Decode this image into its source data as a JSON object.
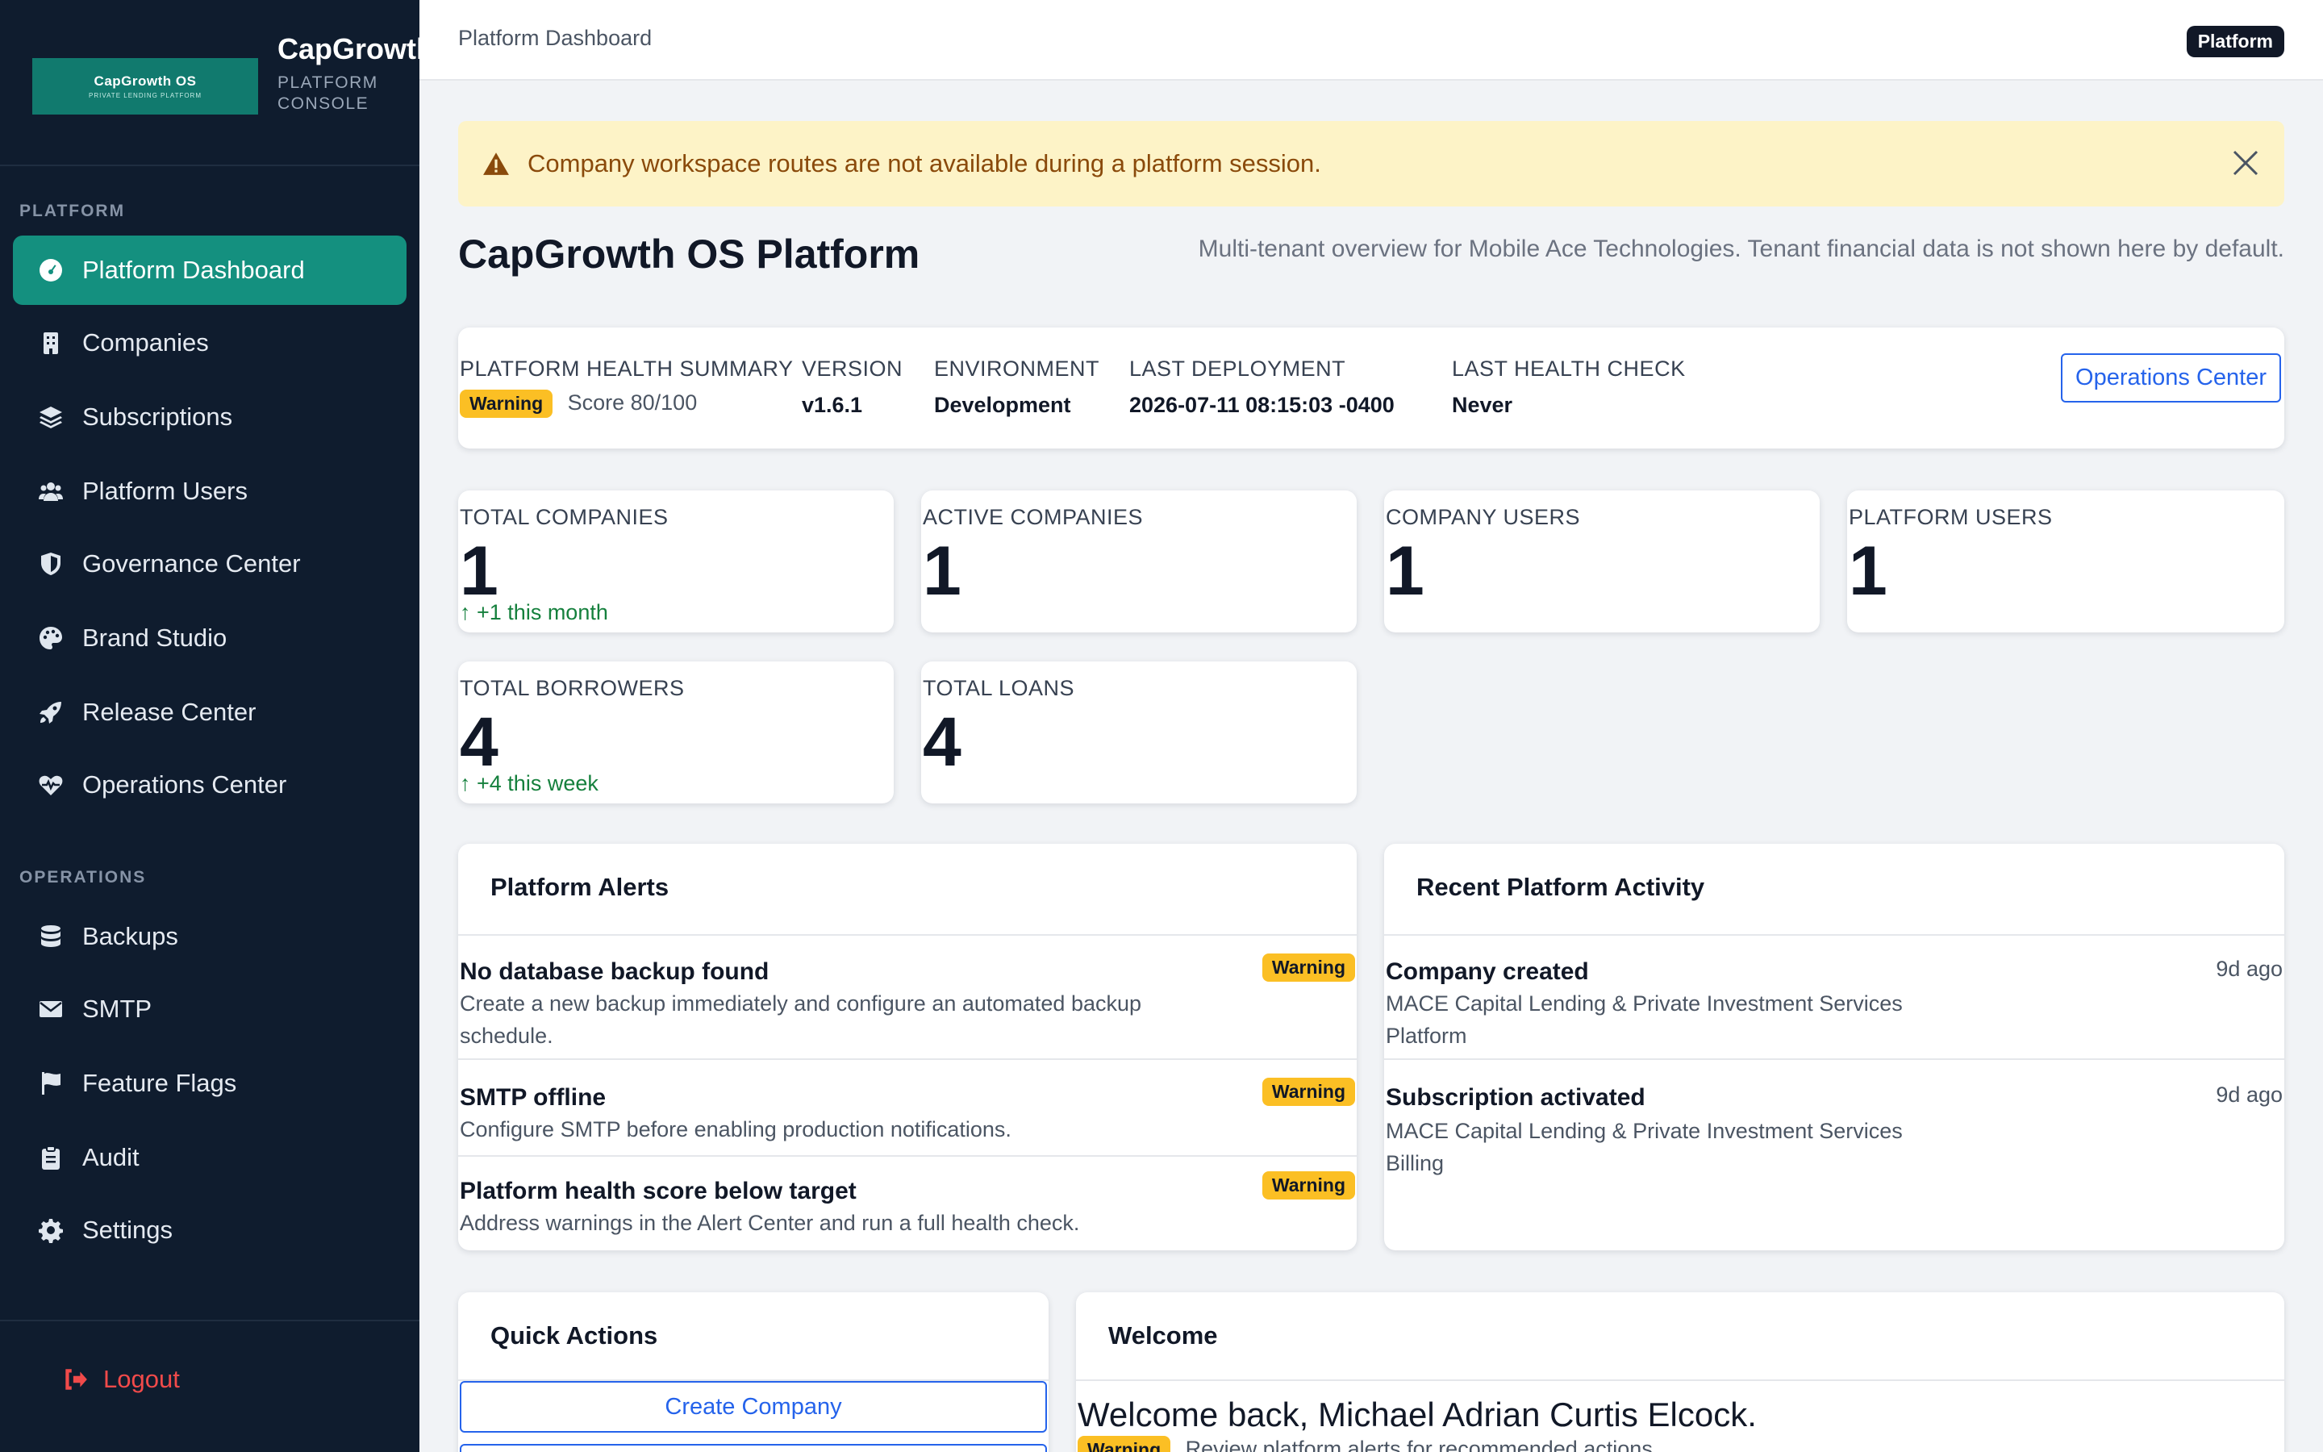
{
  "brand": {
    "logo_line1": "CapGrowth OS",
    "logo_line2": "PRIVATE LENDING PLATFORM",
    "name": "CapGrowth OS",
    "subtitle": "PLATFORM CONSOLE"
  },
  "sidebar": {
    "sections": [
      "PLATFORM",
      "OPERATIONS"
    ],
    "items": [
      {
        "label": "Platform Dashboard",
        "icon": "gauge-icon",
        "active": true
      },
      {
        "label": "Companies",
        "icon": "building-icon"
      },
      {
        "label": "Subscriptions",
        "icon": "layers-icon"
      },
      {
        "label": "Platform Users",
        "icon": "users-icon"
      },
      {
        "label": "Governance Center",
        "icon": "shield-icon"
      },
      {
        "label": "Brand Studio",
        "icon": "palette-icon"
      },
      {
        "label": "Release Center",
        "icon": "rocket-icon"
      },
      {
        "label": "Operations Center",
        "icon": "heartbeat-icon"
      },
      {
        "label": "Backups",
        "icon": "database-icon"
      },
      {
        "label": "SMTP",
        "icon": "envelope-icon"
      },
      {
        "label": "Feature Flags",
        "icon": "flag-icon"
      },
      {
        "label": "Audit",
        "icon": "clipboard-icon"
      },
      {
        "label": "Settings",
        "icon": "gear-icon"
      }
    ],
    "logout": "Logout"
  },
  "topbar": {
    "breadcrumb": "Platform Dashboard",
    "badge": "Platform"
  },
  "alert": {
    "message": "Company workspace routes are not available during a platform session."
  },
  "page": {
    "title": "CapGrowth OS Platform",
    "subtitle": "Multi-tenant overview for Mobile Ace Technologies. Tenant financial data is not shown here by default."
  },
  "health": {
    "summary_label": "PLATFORM HEALTH SUMMARY",
    "status": "Warning",
    "score": "Score 80/100",
    "version_label": "VERSION",
    "version": "v1.6.1",
    "environment_label": "ENVIRONMENT",
    "environment": "Development",
    "deploy_label": "LAST DEPLOYMENT",
    "deploy": "2026-07-11 08:15:03 -0400",
    "check_label": "LAST HEALTH CHECK",
    "check": "Never",
    "ops_button": "Operations Center"
  },
  "stats": [
    {
      "label": "TOTAL COMPANIES",
      "value": "1",
      "delta": "+1 this month"
    },
    {
      "label": "ACTIVE COMPANIES",
      "value": "1",
      "delta": ""
    },
    {
      "label": "COMPANY USERS",
      "value": "1",
      "delta": ""
    },
    {
      "label": "PLATFORM USERS",
      "value": "1",
      "delta": ""
    },
    {
      "label": "TOTAL BORROWERS",
      "value": "4",
      "delta": "+4 this week"
    },
    {
      "label": "TOTAL LOANS",
      "value": "4",
      "delta": ""
    }
  ],
  "alerts_panel": {
    "title": "Platform Alerts",
    "items": [
      {
        "title": "No database backup found",
        "desc": "Create a new backup immediately and configure an automated backup schedule.",
        "badge": "Warning"
      },
      {
        "title": "SMTP offline",
        "desc": "Configure SMTP before enabling production notifications.",
        "badge": "Warning"
      },
      {
        "title": "Platform health score below target",
        "desc": "Address warnings in the Alert Center and run a full health check.",
        "badge": "Warning"
      }
    ]
  },
  "activity_panel": {
    "title": "Recent Platform Activity",
    "items": [
      {
        "title": "Company created",
        "detail": "MACE Capital Lending & Private Investment Services",
        "source": "Platform",
        "ago": "9d ago"
      },
      {
        "title": "Subscription activated",
        "detail": "MACE Capital Lending & Private Investment Services",
        "source": "Billing",
        "ago": "9d ago"
      }
    ]
  },
  "quick_actions": {
    "title": "Quick Actions",
    "buttons": [
      "Create Company"
    ]
  },
  "welcome": {
    "title": "Welcome",
    "heading": "Welcome back, Michael Adrian Curtis Elcock.",
    "badge": "Warning",
    "note": "Review platform alerts for recommended actions."
  },
  "colors": {
    "sidebar_bg": "#0f1c2e",
    "active_item": "#14907f",
    "warning": "#fbbf24",
    "link_blue": "#2563eb",
    "danger": "#f14a4a",
    "positive": "#15803d"
  }
}
